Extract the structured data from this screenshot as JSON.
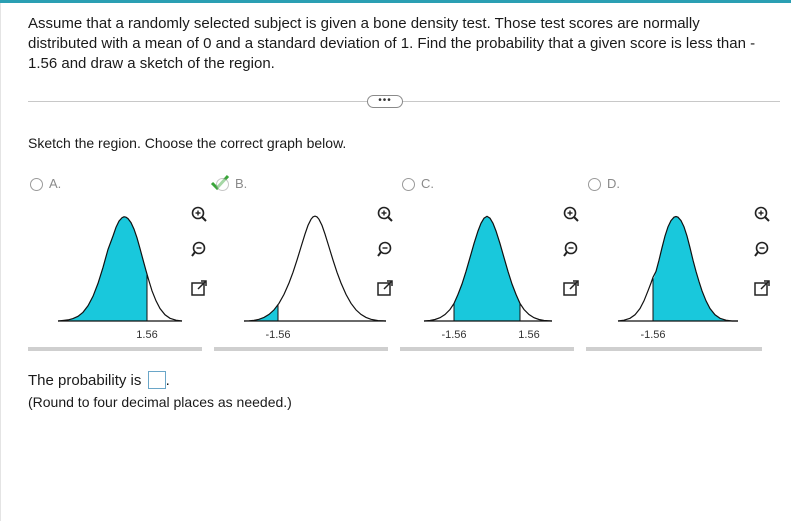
{
  "question": {
    "text": "Assume that a randomly selected subject is given a bone density test. Those test scores are normally distributed with a mean of 0 and a standard deviation of 1. Find the probability that a given score is less than  - 1.56 and draw a sketch of the region."
  },
  "more_button": {
    "label": "•••"
  },
  "prompt": {
    "text": "Sketch the region. Choose the correct graph below."
  },
  "options": [
    {
      "label": "A.",
      "tick_labels": [
        "1.56"
      ],
      "selected": false
    },
    {
      "label": "B.",
      "tick_labels": [
        "-1.56"
      ],
      "selected": true
    },
    {
      "label": "C.",
      "tick_labels": [
        "-1.56",
        "1.56"
      ],
      "selected": false
    },
    {
      "label": "D.",
      "tick_labels": [
        "-1.56"
      ],
      "selected": false
    }
  ],
  "tool_icons": [
    "zoom-in-icon",
    "zoom-out-icon",
    "open-external-icon"
  ],
  "answer": {
    "prefix": "The probability is",
    "suffix": ".",
    "value": ""
  },
  "note": {
    "text": "(Round to four decimal places as needed.)"
  },
  "colors": {
    "accent": "#2a9fb3",
    "fill": "#19c8dc",
    "check": "#3aa63a"
  }
}
